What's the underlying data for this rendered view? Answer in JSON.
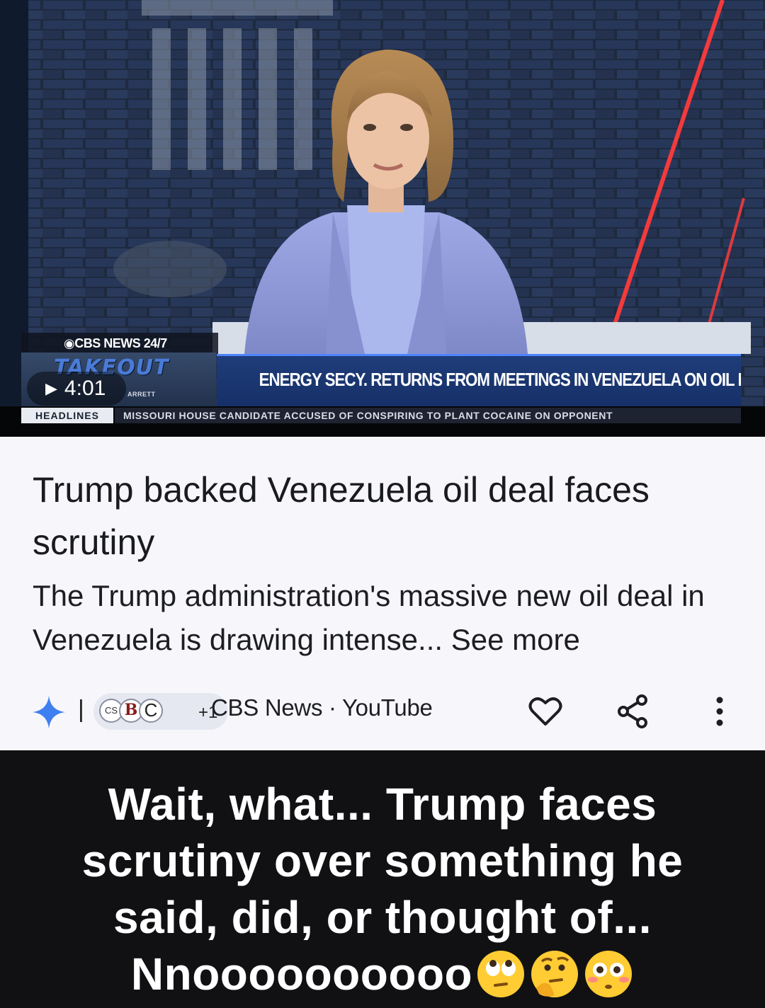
{
  "video": {
    "network_logo": "◉CBS NEWS 24/7",
    "show_name": "TAKEOUT",
    "show_host": "ARRETT",
    "duration": "4:01",
    "headline": "ENERGY SECY. RETURNS FROM MEETINGS IN VENEZUELA ON OIL DEAL",
    "ticker_label": "HEADLINES",
    "ticker_text": "MISSOURI HOUSE CANDIDATE ACCUSED OF CONSPIRING TO PLANT COCAINE ON OPPONENT"
  },
  "card": {
    "title": "Trump backed Venezuela oil deal faces scrutiny",
    "snippet": "The Trump administration's massive new oil deal in Venezuela is drawing intense...",
    "see_more": "See more",
    "sources_more": "+1",
    "source_icon_1": "CS",
    "source_icon_2": "B",
    "source_icon_3": "C",
    "source": "CBS News · YouTube",
    "icons": [
      "sparkle-icon",
      "heart-icon",
      "share-icon",
      "more-vert-icon"
    ]
  },
  "caption": {
    "text": "Wait, what... Trump faces scrutiny over something he said, did, or thought of... Nnoooooooooo",
    "emojis": [
      "face-with-rolling-eyes-emoji",
      "thinking-face-emoji",
      "flushed-face-emoji"
    ]
  },
  "colors": {
    "card_bg": "#f7f7fb",
    "caption_bg": "#111114",
    "lower_third_blue": "#1f3d7a",
    "sparkle_blue": "#3f7ff0"
  }
}
